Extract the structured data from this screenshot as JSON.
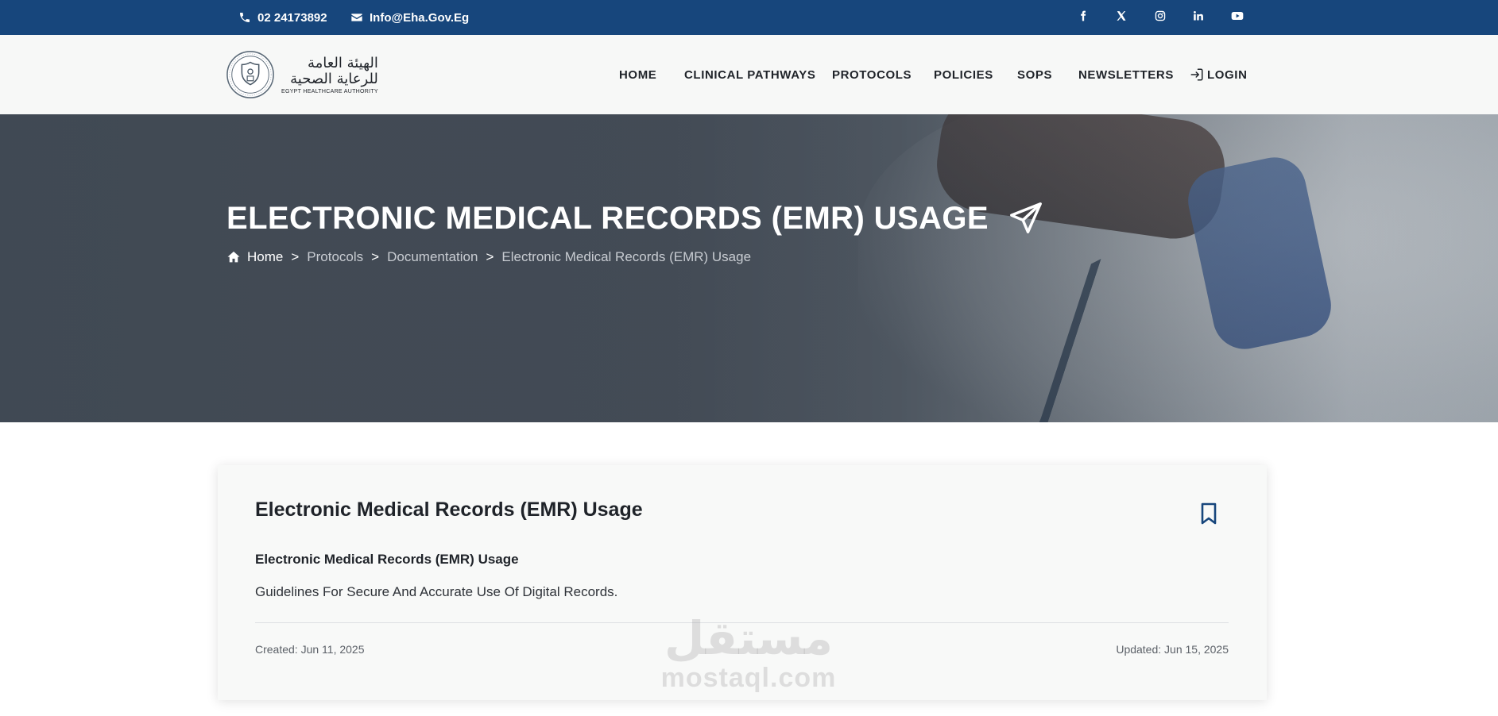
{
  "topbar": {
    "phone": "02 24173892",
    "email": "Info@Eha.Gov.Eg",
    "social": [
      {
        "icon": "facebook-icon"
      },
      {
        "icon": "x-icon"
      },
      {
        "icon": "instagram-icon"
      },
      {
        "icon": "linkedin-icon"
      },
      {
        "icon": "youtube-icon"
      }
    ]
  },
  "logo": {
    "arabic_line1": "الهيئة العامة",
    "arabic_line2": "للرعاية الصحية",
    "english": "EGYPT HEALTHCARE AUTHORITY"
  },
  "nav": {
    "items": [
      "HOME",
      "CLINICAL PATHWAYS",
      "PROTOCOLS",
      "POLICIES",
      "SOPS",
      "NEWSLETTERS"
    ],
    "login": "LOGIN"
  },
  "hero": {
    "title": "ELECTRONIC MEDICAL RECORDS (EMR) USAGE",
    "breadcrumb": {
      "home": "Home",
      "separator": ">",
      "items": [
        "Protocols",
        "Documentation",
        "Electronic Medical Records (EMR) Usage"
      ]
    }
  },
  "card": {
    "title": "Electronic Medical Records (EMR) Usage",
    "subtitle": "Electronic Medical Records (EMR) Usage",
    "description": "Guidelines For Secure And Accurate Use Of Digital Records.",
    "created": "Created: Jun 11, 2025",
    "updated": "Updated: Jun 15, 2025"
  },
  "watermark": {
    "arabic": "مستقل",
    "english": "mostaql.com"
  },
  "colors": {
    "topbar": "#17467c",
    "header_bg": "#f7f8f7",
    "accent": "#17467c",
    "text": "#1f2329"
  }
}
